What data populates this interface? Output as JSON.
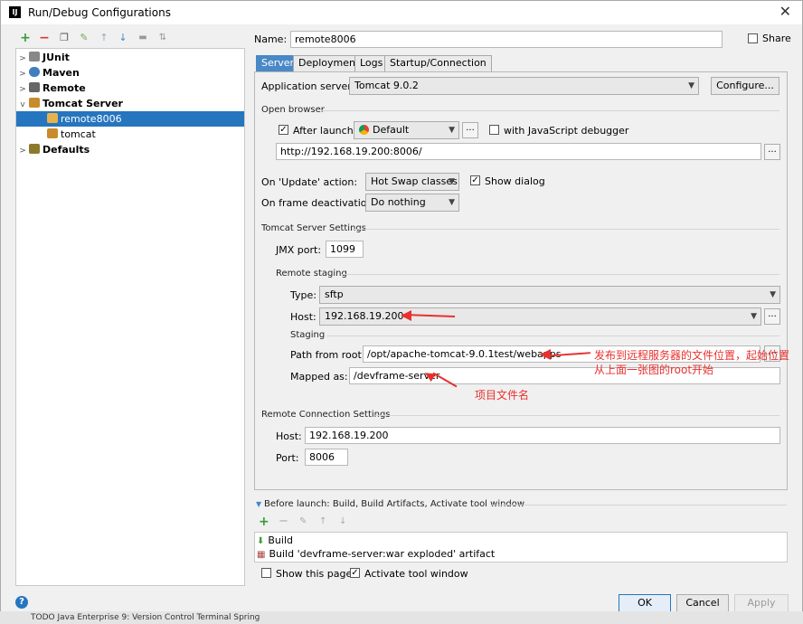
{
  "window": {
    "title": "Run/Debug Configurations",
    "title_icon": "IJ"
  },
  "tree": [
    {
      "label": "JUnit",
      "bold": true,
      "expanded": false,
      "icon_color": "#777777"
    },
    {
      "label": "Maven",
      "bold": true,
      "expanded": false,
      "icon_color": "#3f7fbf"
    },
    {
      "label": "Remote",
      "bold": true,
      "expanded": false,
      "icon_color": "#555555"
    },
    {
      "label": "Tomcat Server",
      "bold": true,
      "expanded": true,
      "icon_color": "#c88b2a"
    },
    {
      "label": "remote8006",
      "bold": false,
      "selected": true,
      "icon_color": "#c88b2a"
    },
    {
      "label": "tomcat",
      "bold": false,
      "icon_color": "#c88b2a"
    },
    {
      "label": "Defaults",
      "bold": true,
      "expanded": false,
      "icon_color": "#8c7a2c"
    }
  ],
  "name": {
    "label": "Name:",
    "value": "remote8006"
  },
  "share": {
    "label": "Share"
  },
  "tabs": [
    "Server",
    "Deployment",
    "Logs",
    "Startup/Connection"
  ],
  "server": {
    "app_server_label": "Application server:",
    "app_server_value": "Tomcat 9.0.2",
    "configure_label": "Configure...",
    "open_browser_title": "Open browser",
    "after_launch_label": "After launch",
    "browser_value": "Default",
    "js_debugger_label": "with JavaScript debugger",
    "url_value": "http://192.168.19.200:8006/",
    "on_update_label": "On 'Update' action:",
    "on_update_value": "Hot Swap classes",
    "show_dialog_label": "Show dialog",
    "on_frame_label": "On frame deactivation:",
    "on_frame_value": "Do nothing",
    "tomcat_settings_title": "Tomcat Server Settings",
    "jmx_label": "JMX port:",
    "jmx_value": "1099",
    "remote_staging_title": "Remote staging",
    "type_label": "Type:",
    "type_value": "sftp",
    "host_label": "Host:",
    "host_value": "192.168.19.200",
    "staging_title": "Staging",
    "path_label": "Path from root:",
    "path_value": "/opt/apache-tomcat-9.0.1test/webapps",
    "mapped_label": "Mapped as:",
    "mapped_value": "/devframe-server",
    "remote_conn_title": "Remote Connection Settings",
    "rc_host_label": "Host:",
    "rc_host_value": "192.168.19.200",
    "rc_port_label": "Port:",
    "rc_port_value": "8006"
  },
  "annotations": {
    "path_note": "发布到远程服务器的文件位置，起始位置从上面一张图的root开始",
    "mapped_note": "项目文件名"
  },
  "before_launch": {
    "title": "Before launch: Build, Build Artifacts, Activate tool window",
    "items": [
      "Build",
      "Build 'devframe-server:war exploded' artifact"
    ],
    "show_page_label": "Show this page",
    "activate_label": "Activate tool window"
  },
  "buttons": {
    "ok": "OK",
    "cancel": "Cancel",
    "apply": "Apply"
  },
  "background_strip": "TODO    Java Enterprise    9: Version Control    Terminal    Spring"
}
